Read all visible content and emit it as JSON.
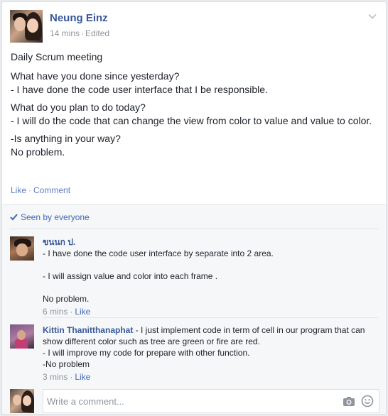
{
  "post": {
    "author": "Neung Einz",
    "time": "14 mins",
    "edited_label": "Edited",
    "dot": "·",
    "lines": {
      "title": "Daily Scrum meeting",
      "q1": "What have you done since yesterday?",
      "a1": "- I have done the code user interface that I be responsible.",
      "q2": "What do you plan to do today?",
      "a2": "- I will do the code that can change the view from color to value and value to color.",
      "q3": "-Is anything in your way?",
      "a3": "No problem."
    },
    "actions": {
      "like": "Like",
      "comment": "Comment",
      "sep": "·"
    }
  },
  "seen": {
    "label": "Seen by everyone"
  },
  "comments": [
    {
      "author": "ขนนก ป.",
      "lines": [
        "- I have done the code user interface by separate into 2 area.",
        "- I will assign value and color into each frame .",
        "No problem."
      ],
      "time": "6 mins",
      "like": "Like"
    },
    {
      "author": "Kittin Thanitthanaphat",
      "text": " - I just implement code in term of cell in our program that can show different color such as tree are green or fire are red.",
      "lines": [
        "- I will improve my code for prepare with other function.",
        "-No problem"
      ],
      "time": "3 mins",
      "like": "Like"
    }
  ],
  "composer": {
    "placeholder": "Write a comment..."
  },
  "colors": {
    "link": "#365899",
    "accent": "#4267b2",
    "meta": "#90949c"
  },
  "icons": [
    "chevron-down-icon",
    "check-icon",
    "camera-icon",
    "smile-icon"
  ]
}
